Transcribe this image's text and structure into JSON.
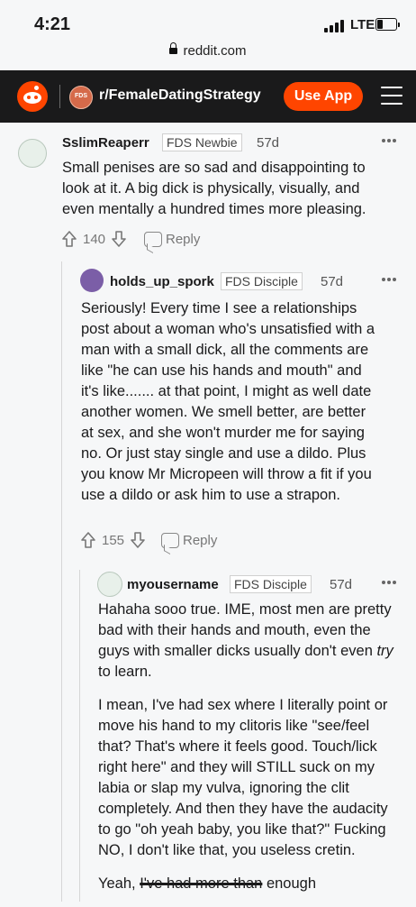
{
  "status": {
    "time": "4:21",
    "network": "LTE"
  },
  "browser": {
    "url": "reddit.com"
  },
  "header": {
    "subreddit": "r/FemaleDatingStrategy",
    "subreddit_icon_text": "FDS",
    "use_app": "Use App"
  },
  "comments": [
    {
      "author": "SslimReaperr",
      "flair": "FDS Newbie",
      "age": "57d",
      "body": "Small penises are so sad and disappointing to look at it. A big dick is physically, visually, and even mentally a hundred times more pleasing.",
      "score": "140",
      "reply": "Reply"
    },
    {
      "author": "holds_up_spork",
      "flair": "FDS Disciple",
      "age": "57d",
      "body": "Seriously! Every time I see a relationships post about a woman who's unsatisfied with a man with a small dick, all the comments are like \"he can use his hands and mouth\" and it's like....... at that point, I might as well date another women. We smell better, are better at sex, and she won't murder me for saying no. Or just stay single and use a dildo. Plus you know Mr Micropeen will throw a fit if you use a dildo or ask him to use a strapon.",
      "score": "155",
      "reply": "Reply"
    },
    {
      "author": "myousername",
      "flair": "FDS Disciple",
      "age": "57d",
      "para1_a": "Hahaha sooo true. IME, most men are pretty bad with their hands and mouth, even the guys with smaller dicks usually don't even ",
      "para1_em": "try",
      "para1_b": " to learn.",
      "para2": "I mean, I've had sex where I literally point or move his hand to my clitoris like \"see/feel that? That's where it feels good. Touch/lick right here\" and they will STILL suck on my labia or slap my vulva, ignoring the clit completely. And then they have the audacity to go \"oh yeah baby, you like that?\" Fucking NO, I don't like that, you useless cretin.",
      "para3_a": "Yeah, ",
      "para3_strike": "I've had more than",
      "para3_b": " enough"
    }
  ],
  "colors": {
    "header_bg": "#1a1a1b",
    "accent": "#ff4500",
    "page_bg": "#f6f7f8"
  }
}
